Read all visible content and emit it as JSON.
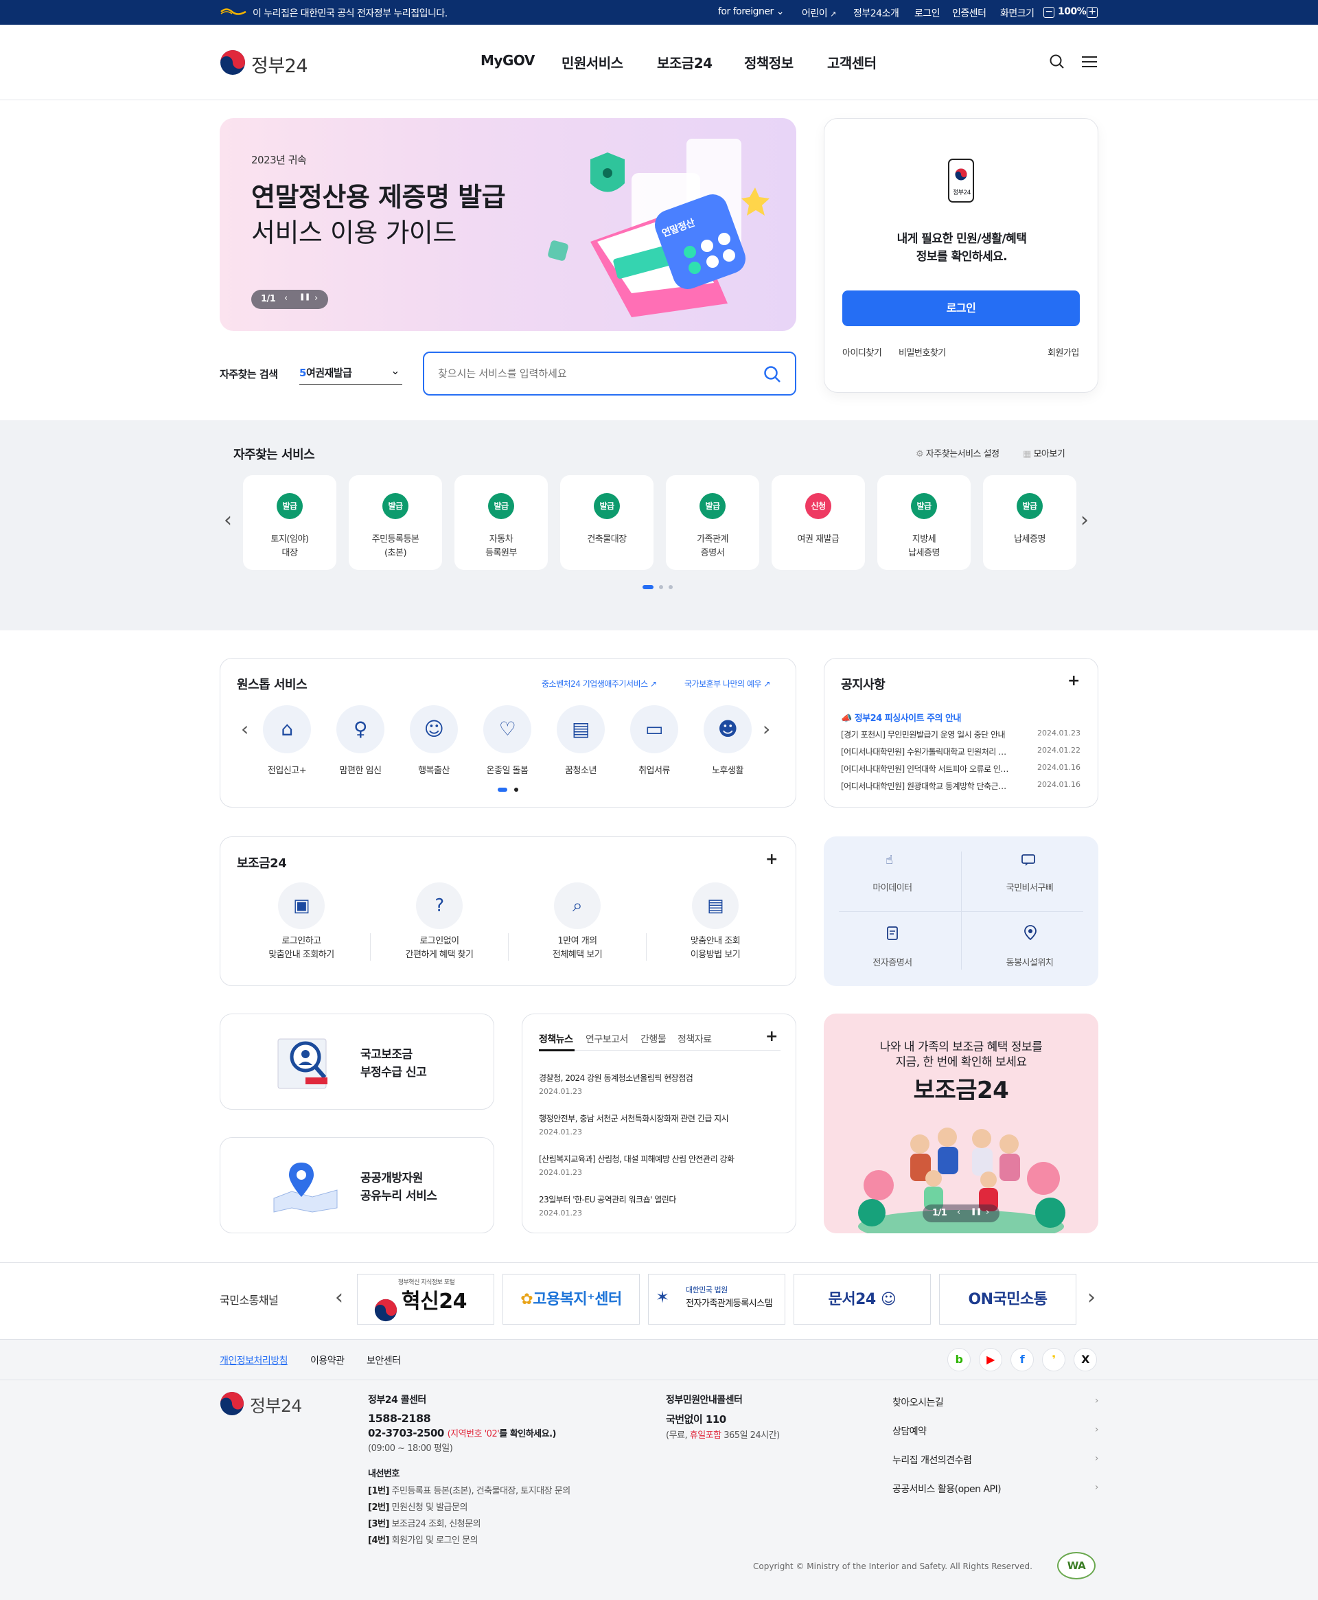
{
  "topbar": {
    "notice": "이 누리집은 대한민국 공식 전자정부 누리집입니다.",
    "foreigner": "for foreigner",
    "kids": "어린이",
    "about": "정부24소개",
    "login": "로그인",
    "cert": "인증센터",
    "fontsize": "화면크기",
    "zoom": "100%"
  },
  "header": {
    "logo": "정부24",
    "nav": [
      "MyGOV",
      "민원서비스",
      "보조금24",
      "정책정보",
      "고객센터"
    ]
  },
  "hero": {
    "eyebrow": "2023년 귀속",
    "title": "연말정산용 제증명 발급",
    "subtitle": "서비스 이용 가이드",
    "pager": "1/1",
    "calc_label": "연말정산"
  },
  "login": {
    "app_label": "정부24",
    "desc1": "내게 필요한 민원/생활/혜택",
    "desc2": "정보를 확인하세요.",
    "button": "로그인",
    "find_id": "아이디찾기",
    "find_pw": "비밀번호찾기",
    "signup": "회원가입"
  },
  "search": {
    "label": "자주찾는 검색",
    "keyword_rank": "5",
    "keyword": "여권재발급",
    "placeholder": "찾으시는 서비스를 입력하세요"
  },
  "freq": {
    "title": "자주찾는 서비스",
    "setting": "자주찾는서비스 설정",
    "more": "모아보기",
    "items": [
      {
        "badge": "발급",
        "l1": "토지(임야)",
        "l2": "대장"
      },
      {
        "badge": "발급",
        "l1": "주민등록등본",
        "l2": "(초본)"
      },
      {
        "badge": "발급",
        "l1": "자동차",
        "l2": "등록원부"
      },
      {
        "badge": "발급",
        "l1": "건축물대장",
        "l2": ""
      },
      {
        "badge": "발급",
        "l1": "가족관계",
        "l2": "증명서"
      },
      {
        "badge": "신청",
        "l1": "여권 재발급",
        "l2": ""
      },
      {
        "badge": "발급",
        "l1": "지방세",
        "l2": "납세증명"
      },
      {
        "badge": "발급",
        "l1": "납세증명",
        "l2": ""
      }
    ]
  },
  "onestop": {
    "title": "원스톱 서비스",
    "link1": "중소벤처24 기업생애주기서비스",
    "link2": "국가보훈부 나만의 예우",
    "items": [
      "전입신고+",
      "맘편한 임신",
      "행복출산",
      "온종일 돌봄",
      "꿈청소년",
      "취업서류",
      "노후생활"
    ]
  },
  "notice": {
    "title": "공지사항",
    "headline": "정부24 피싱사이트 주의 안내",
    "items": [
      {
        "t": "[경기 포천시] 무인민원발급기 운영 일시 중단 안내",
        "d": "2024.01.23"
      },
      {
        "t": "[어디서나대학민원] 수원가톨릭대학교 민원처리 …",
        "d": "2024.01.22"
      },
      {
        "t": "[어디서나대학민원] 인덕대학 서트피아 오류로 인…",
        "d": "2024.01.16"
      },
      {
        "t": "[어디서나대학민원] 원광대학교 동계방학 단축근…",
        "d": "2024.01.16"
      }
    ]
  },
  "subsidy": {
    "title": "보조금24",
    "items": [
      {
        "l1": "로그인하고",
        "l2": "맞춤안내 조회하기"
      },
      {
        "l1": "로그인없이",
        "l2": "간편하게 혜택 찾기"
      },
      {
        "l1": "1만여 개의",
        "l2": "전체혜택 보기"
      },
      {
        "l1": "맞춤안내 조회",
        "l2": "이용방법 보기"
      }
    ]
  },
  "quick": {
    "items": [
      "마이데이터",
      "국민비서구삐",
      "전자증명서",
      "동봉시설위치"
    ]
  },
  "report": {
    "l1": "국고보조금",
    "l2": "부정수급 신고"
  },
  "opendata": {
    "l1": "공공개방자원",
    "l2": "공유누리 서비스"
  },
  "news": {
    "tabs": [
      "정책뉴스",
      "연구보고서",
      "간행물",
      "정책자료"
    ],
    "items": [
      {
        "t": "경찰청, 2024 강원 동계청소년올림픽 현장점검",
        "d": "2024.01.23"
      },
      {
        "t": "행정안전부, 충남 서천군 서천특화시장화재 관련 긴급 지시",
        "d": "2024.01.23"
      },
      {
        "t": "[산림복지교육과] 산림청, 대설 피해예방 산림 안전관리 강화",
        "d": "2024.01.23"
      },
      {
        "t": "23일부터 '한-EU 공역관리 워크숍' 열린다",
        "d": "2024.01.23"
      }
    ]
  },
  "promo": {
    "l1": "나와 내 가족의 보조금 혜택 정보를",
    "l2": "지금, 한 번에 확인해 보세요",
    "big": "보조금24",
    "pager": "1/1"
  },
  "channels": {
    "title": "국민소통채널",
    "items": [
      "혁신24",
      "고용복지⁺센터",
      "전자가족관계등록시스템",
      "문서24",
      "ON국민소통"
    ],
    "hyeoksin_sub": "정부혁신 지식정보 포털",
    "family_sub": "대한민국 법원"
  },
  "footer_links": [
    "개인정보처리방침",
    "이용약관",
    "보안센터"
  ],
  "footer": {
    "logo": "정부24",
    "call_title": "정부24 콜센터",
    "call_no": "1588-2188",
    "call_no2": "02-3703-2500",
    "call_note_red": "(지역번호 '02'",
    "call_note": "를 확인하세요.)",
    "hours": "(09:00 ~ 18:00 평일)",
    "ext_title": "내선번호",
    "ext": [
      {
        "n": "[1번]",
        "t": "주민등록표 등본(초본), 건축물대장, 토지대장 문의"
      },
      {
        "n": "[2번]",
        "t": "민원신청 및 발급문의"
      },
      {
        "n": "[3번]",
        "t": "보조금24 조회, 신청문의"
      },
      {
        "n": "[4번]",
        "t": "회원가입 및 로그인 문의"
      }
    ],
    "gov_title": "정부민원안내콜센터",
    "gov_no": "국번없이 110",
    "gov_note1": "(무료,",
    "gov_note_red": "휴일포함",
    "gov_note2": "365일 24시간)",
    "links": [
      "찾아오시는길",
      "상담예약",
      "누리집 개선의견수렴",
      "공공서비스 활용(open API)"
    ],
    "copyright": "Copyright © Ministry of the Interior and Safety. All Rights Reserved.",
    "wa": "WA"
  },
  "colors": {
    "navy": "#0b2f6e",
    "blue": "#256ef4",
    "green": "#0d9b6d",
    "red": "#ee3a62"
  }
}
